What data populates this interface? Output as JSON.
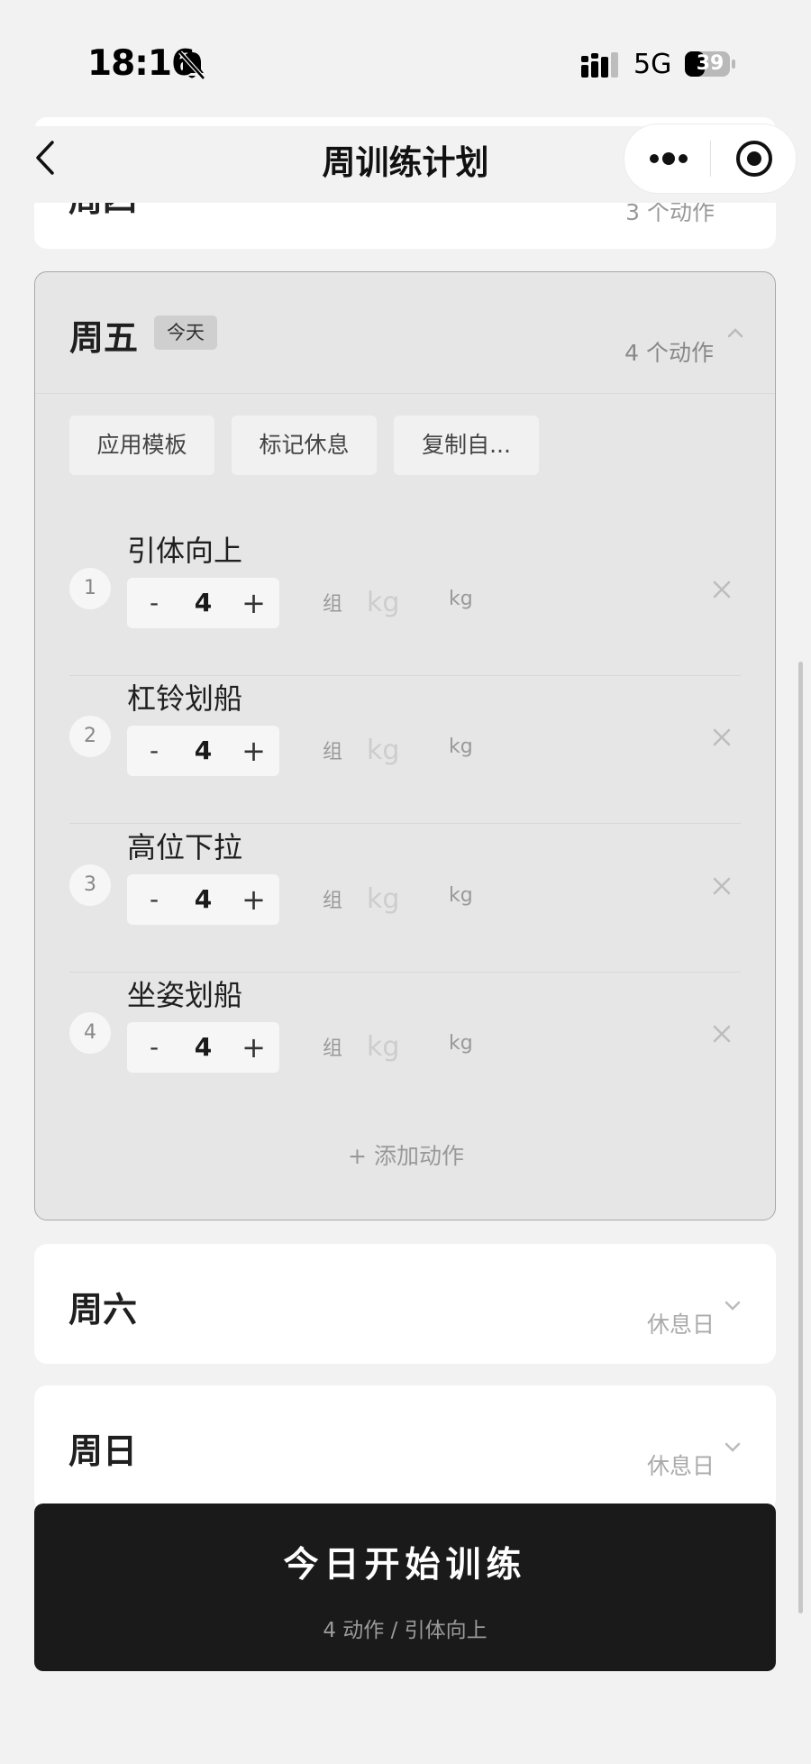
{
  "status_bar": {
    "time": "18:16",
    "network": "5G",
    "battery": "39"
  },
  "header": {
    "title": "周训练计划"
  },
  "days": {
    "prev": {
      "name": "周四",
      "summary": "3 个动作"
    },
    "today": {
      "name": "周五",
      "badge": "今天",
      "summary": "4 个动作",
      "tools": [
        "应用模板",
        "标记休息",
        "复制自..."
      ],
      "exercises": [
        {
          "index": "1",
          "name": "引体向上",
          "sets": "4",
          "weight": ""
        },
        {
          "index": "2",
          "name": "杠铃划船",
          "sets": "4",
          "weight": ""
        },
        {
          "index": "3",
          "name": "高位下拉",
          "sets": "4",
          "weight": ""
        },
        {
          "index": "4",
          "name": "坐姿划船",
          "sets": "4",
          "weight": ""
        }
      ],
      "add_label": "+ 添加动作"
    },
    "sat": {
      "name": "周六",
      "summary": "休息日"
    },
    "sun": {
      "name": "周日",
      "summary": "休息日"
    }
  },
  "labels": {
    "minus": "-",
    "plus": "+",
    "unit_sets": "组",
    "unit_kg": "kg",
    "weight_placeholder": "kg"
  },
  "start": {
    "label": "今日开始训练",
    "sub": "4 动作 / 引体向上"
  },
  "colors": {
    "accent": "#1a1a1a",
    "card_active_bg": "#e6e6e6",
    "page_bg": "#f2f2f2"
  }
}
